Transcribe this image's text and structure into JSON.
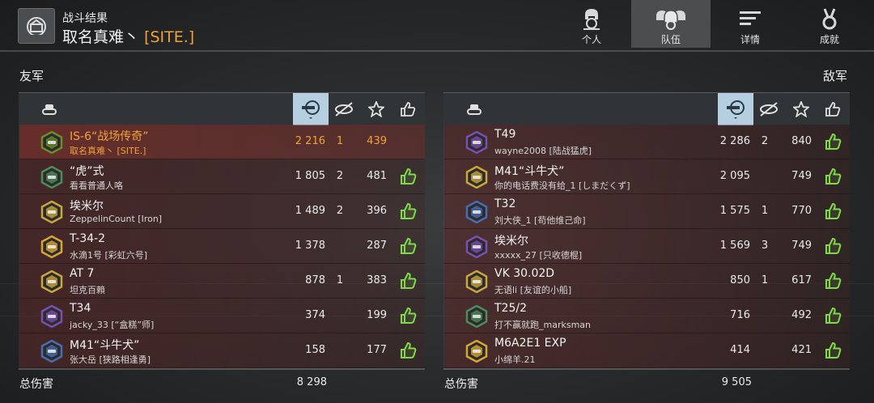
{
  "header": {
    "subtitle": "战斗结果",
    "player_name": "取名真难丶",
    "clan_tag": "[SITE.]"
  },
  "tabs": [
    {
      "label": "个人",
      "icon": "helmet-icon",
      "active": false
    },
    {
      "label": "队伍",
      "icon": "team-icon",
      "active": true
    },
    {
      "label": "详情",
      "icon": "list-icon",
      "active": false
    },
    {
      "label": "成就",
      "icon": "medal-icon",
      "active": false
    }
  ],
  "allies": {
    "title": "友军",
    "total_label": "总伤害",
    "total_damage": "8 298",
    "rows": [
      {
        "tank": "IS-6“战场传奇”",
        "player": "取名真难丶 [SITE.]",
        "damage": "2 216",
        "kills": "1",
        "exp": "439",
        "self": true,
        "emblem_color": "#6a8c2e",
        "liked": false
      },
      {
        "tank": "“虎”式",
        "player": "看看普通人咯",
        "damage": "1 805",
        "kills": "2",
        "exp": "481",
        "self": false,
        "emblem_color": "#4f8a5a",
        "liked": true
      },
      {
        "tank": "埃米尔",
        "player": "ZeppelinCount [Iron]",
        "damage": "1 489",
        "kills": "2",
        "exp": "396",
        "self": false,
        "emblem_color": "#c8a640",
        "liked": true
      },
      {
        "tank": "T-34-2",
        "player": "水滴1号 [彩虹六号]",
        "damage": "1 378",
        "kills": "",
        "exp": "287",
        "self": false,
        "emblem_color": "#d7a535",
        "liked": true
      },
      {
        "tank": "AT 7",
        "player": "坦克百賴",
        "damage": "878",
        "kills": "1",
        "exp": "383",
        "self": false,
        "emblem_color": "#c8a640",
        "liked": true
      },
      {
        "tank": "T34",
        "player": "jacky_33 [“盒糕”师]",
        "damage": "374",
        "kills": "",
        "exp": "199",
        "self": false,
        "emblem_color": "#7a4fb0",
        "liked": true
      },
      {
        "tank": "M41“斗牛犬”",
        "player": "张大岳 [狭路相逢勇]",
        "damage": "158",
        "kills": "",
        "exp": "177",
        "self": false,
        "emblem_color": "#4a6cb0",
        "liked": true
      }
    ]
  },
  "enemies": {
    "title": "敌军",
    "total_label": "总伤害",
    "total_damage": "9 505",
    "rows": [
      {
        "tank": "T49",
        "player": "wayne2008 [陆战猛虎]",
        "damage": "2 286",
        "kills": "2",
        "exp": "840",
        "self": false,
        "emblem_color": "#7a4fb0",
        "liked": true
      },
      {
        "tank": "M41“斗牛犬”",
        "player": "你的电话费没有给_1 [しまだくず]",
        "damage": "2 095",
        "kills": "",
        "exp": "749",
        "self": false,
        "emblem_color": "#c8a640",
        "liked": true
      },
      {
        "tank": "T32",
        "player": "刘大侠_1 [苟他维己命]",
        "damage": "1 575",
        "kills": "1",
        "exp": "770",
        "self": false,
        "emblem_color": "#4a6cb0",
        "liked": true
      },
      {
        "tank": "埃米尔",
        "player": "xxxxx_27 [只收德棍]",
        "damage": "1 569",
        "kills": "3",
        "exp": "749",
        "self": false,
        "emblem_color": "#7a4fb0",
        "liked": true
      },
      {
        "tank": "VK 30.02D",
        "player": "无语li [友谊的小船]",
        "damage": "850",
        "kills": "1",
        "exp": "617",
        "self": false,
        "emblem_color": "#c8a640",
        "liked": true
      },
      {
        "tank": "T25/2",
        "player": "打不赢就跑_marksman",
        "damage": "716",
        "kills": "",
        "exp": "492",
        "self": false,
        "emblem_color": "#4f8a5a",
        "liked": true
      },
      {
        "tank": "M6A2E1 EXP",
        "player": "小绵羊.21",
        "damage": "414",
        "kills": "",
        "exp": "421",
        "self": false,
        "emblem_color": "#d7a535",
        "liked": true
      }
    ]
  },
  "columns": {
    "icons": [
      "tank-icon",
      "damage-icon",
      "kills-icon",
      "star-icon",
      "like-icon"
    ]
  },
  "colors": {
    "self_highlight": "#f0a33a",
    "sort_active": "#b6cfe0",
    "like_green": "#7fd94a"
  }
}
